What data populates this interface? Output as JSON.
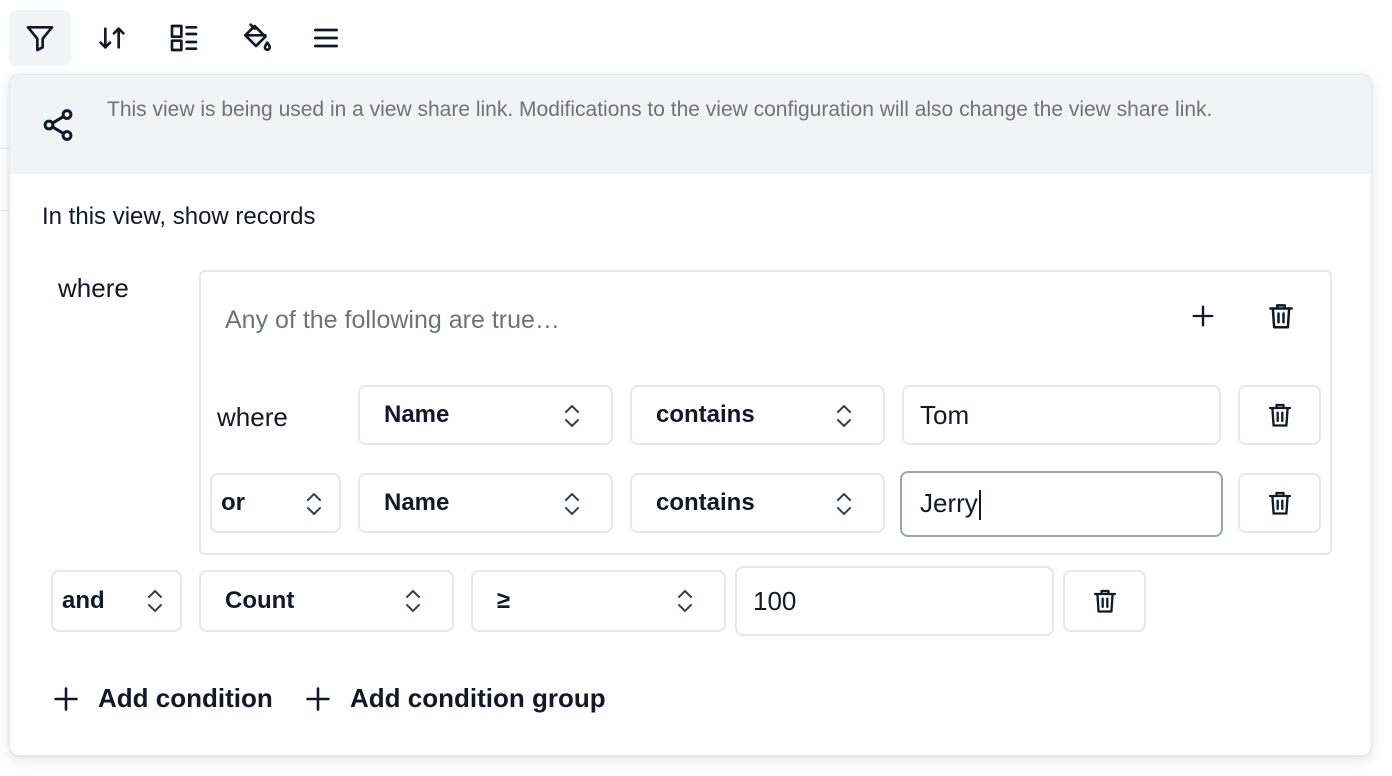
{
  "toolbar": {
    "buttons": [
      {
        "name": "filter",
        "icon": "filter-icon",
        "active": true
      },
      {
        "name": "sort",
        "icon": "sort-icon"
      },
      {
        "name": "group",
        "icon": "group-icon"
      },
      {
        "name": "color",
        "icon": "paint-bucket-icon"
      },
      {
        "name": "row-height",
        "icon": "menu-icon"
      }
    ]
  },
  "share_banner": {
    "icon": "share-icon",
    "text": "This view is being used in a view share link. Modifications to the view configuration will also change the view share link."
  },
  "filter": {
    "intro": "In this view, show records",
    "where_label": "where",
    "group": {
      "label": "Any of the following are true…",
      "add_icon": "plus-icon",
      "delete_icon": "trash-icon",
      "conditions": [
        {
          "conjunction": "where",
          "field": "Name",
          "operator": "contains",
          "value": "Tom"
        },
        {
          "conjunction": "or",
          "field": "Name",
          "operator": "contains",
          "value": "Jerry"
        }
      ]
    },
    "conditions": [
      {
        "conjunction": "and",
        "field": "Count",
        "operator": "≥",
        "value": "100"
      }
    ],
    "add_condition_label": "Add condition",
    "add_group_label": "Add condition group"
  },
  "colors": {
    "banner_bg": "#f2f3f5",
    "muted_text": "#6b7280",
    "border": "#e5e7eb"
  }
}
